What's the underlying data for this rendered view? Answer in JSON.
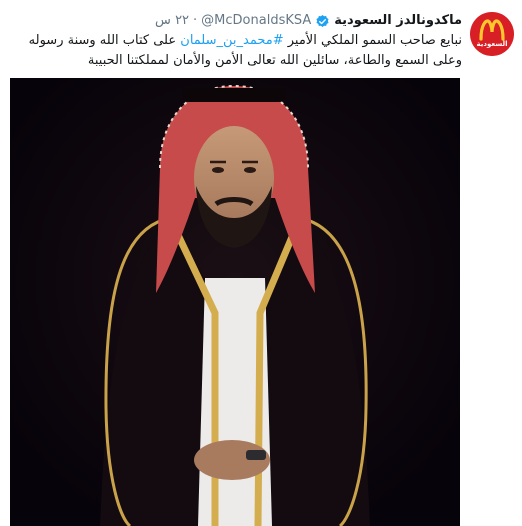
{
  "tweet": {
    "avatar": {
      "icon": "mcdonalds-logo-icon",
      "caption": "السعودية",
      "color": "#d81f26",
      "arch_color": "#ffc72c"
    },
    "display_name": "ماكدونالدز السعودية",
    "verified_icon": "verified-badge-icon",
    "handle": "@McDonaldsKSA",
    "separator": "·",
    "timestamp": "٢٢ س",
    "text_before_hashtag": "نبايع صاحب السمو الملكي الأمير ",
    "hashtag": "#محمد_بن_سلمان",
    "text_after_hashtag": " على كتاب الله وسنة رسوله وعلى السمع والطاعة، سائلين الله تعالى الأمن والأمان لمملكتنا الحبيبة",
    "media": {
      "image": "portrait-photo",
      "background": "#0d070b"
    }
  }
}
